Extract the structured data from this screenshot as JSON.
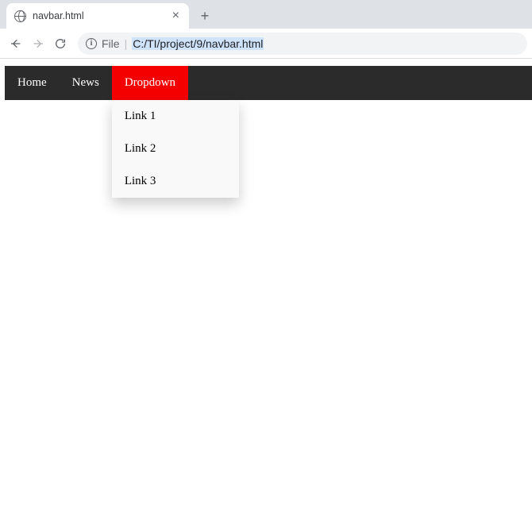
{
  "browser": {
    "tab_title": "navbar.html",
    "file_label": "File",
    "url": "C:/TI/project/9/navbar.html"
  },
  "navbar": {
    "items": [
      {
        "label": "Home"
      },
      {
        "label": "News"
      }
    ],
    "dropdown": {
      "label": "Dropdown",
      "items": [
        {
          "label": "Link 1"
        },
        {
          "label": "Link 2"
        },
        {
          "label": "Link 3"
        }
      ]
    }
  }
}
